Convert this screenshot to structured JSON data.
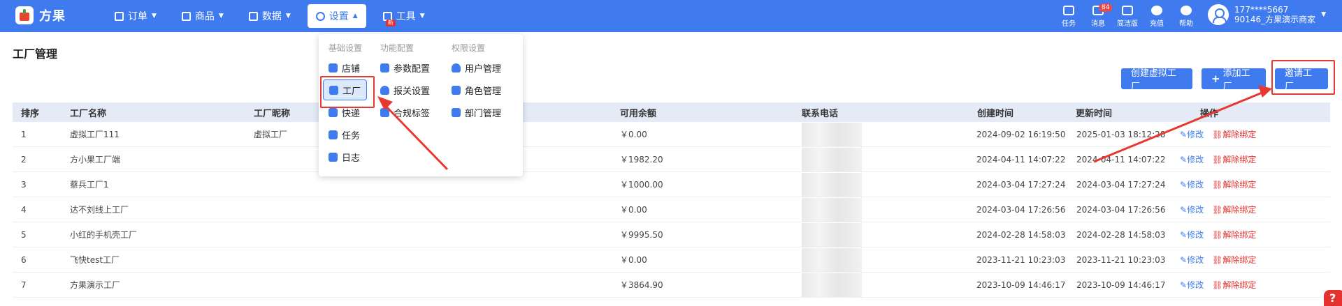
{
  "brand": {
    "name": "方果"
  },
  "nav": [
    {
      "label": "订单",
      "icon": "order-icon"
    },
    {
      "label": "商品",
      "icon": "goods-icon"
    },
    {
      "label": "数据",
      "icon": "chart-icon"
    },
    {
      "label": "设置",
      "icon": "gear-icon",
      "active": true
    },
    {
      "label": "工具",
      "icon": "box-icon",
      "badge": "新"
    }
  ],
  "tools": [
    {
      "label": "任务",
      "icon": "task-icon"
    },
    {
      "label": "消息",
      "icon": "message-icon",
      "badge": "84"
    },
    {
      "label": "简洁版",
      "icon": "shirt-icon"
    },
    {
      "label": "充值",
      "icon": "recharge-icon"
    },
    {
      "label": "帮助",
      "icon": "help-icon"
    }
  ],
  "user": {
    "phone": "177****5667",
    "shop": "90146_方果演示商家"
  },
  "page": {
    "title": "工厂管理"
  },
  "buttons": {
    "create": "创建虚拟工厂",
    "add": "添加工厂",
    "invite": "邀请工厂"
  },
  "table": {
    "headers": [
      "排序",
      "工厂名称",
      "工厂昵称",
      "可用余额",
      "联系电话",
      "创建时间",
      "更新时间",
      "操作"
    ],
    "rows": [
      {
        "idx": "1",
        "name": "虚拟工厂111",
        "nick": "虚拟工厂",
        "balance": "￥0.00",
        "created": "2024-09-02 16:19:50",
        "updated": "2025-01-03 18:12:28"
      },
      {
        "idx": "2",
        "name": "方小果工厂端",
        "nick": "",
        "balance": "￥1982.20",
        "created": "2024-04-11 14:07:22",
        "updated": "2024-04-11 14:07:22"
      },
      {
        "idx": "3",
        "name": "蔡兵工厂1",
        "nick": "",
        "balance": "￥1000.00",
        "created": "2024-03-04 17:27:24",
        "updated": "2024-03-04 17:27:24"
      },
      {
        "idx": "4",
        "name": "达不刘线上工厂",
        "nick": "",
        "balance": "￥0.00",
        "created": "2024-03-04 17:26:56",
        "updated": "2024-03-04 17:26:56"
      },
      {
        "idx": "5",
        "name": "小红的手机壳工厂",
        "nick": "",
        "balance": "￥9995.50",
        "created": "2024-02-28 14:58:03",
        "updated": "2024-02-28 14:58:03"
      },
      {
        "idx": "6",
        "name": "飞快test工厂",
        "nick": "",
        "balance": "￥0.00",
        "created": "2023-11-21 10:23:03",
        "updated": "2023-11-21 10:23:03"
      },
      {
        "idx": "7",
        "name": "方果演示工厂",
        "nick": "",
        "balance": "￥3864.90",
        "created": "2023-10-09 14:46:17",
        "updated": "2023-10-09 14:46:17"
      }
    ],
    "ops": {
      "edit": "修改",
      "unbind": "解除绑定"
    }
  },
  "dropdown": {
    "col1": {
      "title": "基础设置",
      "items": [
        "店铺",
        "工厂",
        "快递",
        "任务",
        "日志"
      ]
    },
    "col2": {
      "title": "功能配置",
      "items": [
        "参数配置",
        "报关设置",
        "合规标签"
      ]
    },
    "col3": {
      "title": "权限设置",
      "items": [
        "用户管理",
        "角色管理",
        "部门管理"
      ]
    }
  },
  "colors": {
    "primary": "#3f7bef",
    "annotation": "#e8382f",
    "danger": "#e5322f"
  }
}
